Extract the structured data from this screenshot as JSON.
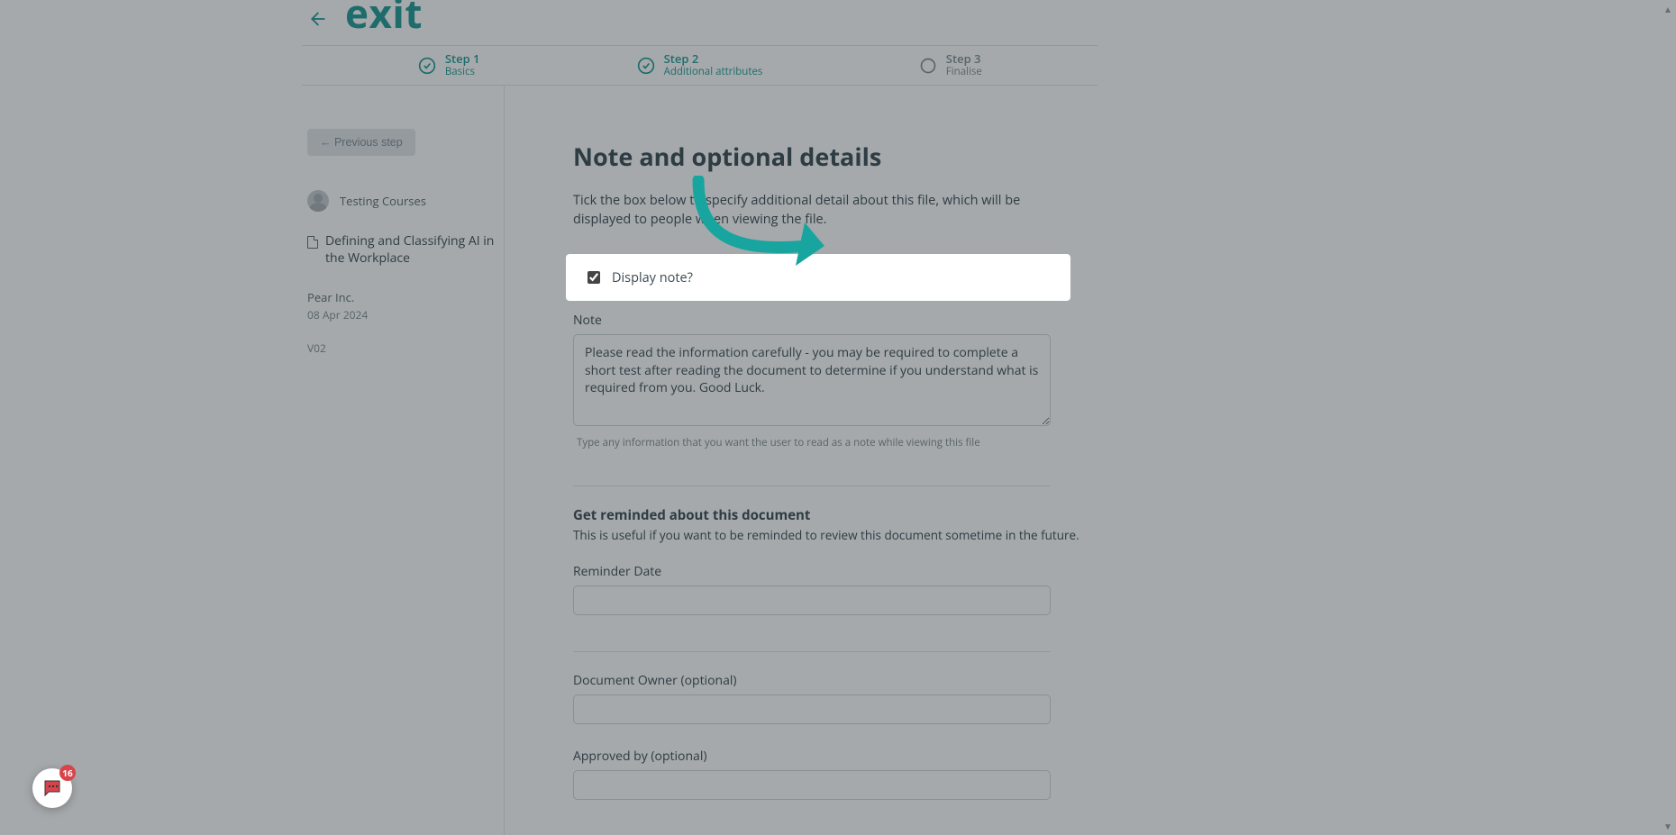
{
  "header": {
    "exit_label": "exit"
  },
  "steps": [
    {
      "num": "Step 1",
      "label": "Basics",
      "state": "done"
    },
    {
      "num": "Step 2",
      "label": "Additional attributes",
      "state": "done"
    },
    {
      "num": "Step 3",
      "label": "Finalise",
      "state": "pending"
    }
  ],
  "left": {
    "prev_button": "← Previous step",
    "course_name": "Testing Courses",
    "doc_title": "Defining and Classifying AI in the Workplace",
    "company": "Pear Inc.",
    "date": "08 Apr 2024",
    "version": "V02"
  },
  "right": {
    "section_title": "Note and optional details",
    "section_desc": "Tick the box below to specify additional detail about this file, which will be displayed to people when viewing the file.",
    "display_note_label": "Display note?",
    "display_note_checked": true,
    "note_label": "Note",
    "note_value": "Please read the information carefully - you may be required to complete a short test after reading the document to determine if you understand what is required from you. Good Luck.",
    "note_hint": "Type any information that you want the user to read as a note while viewing this file",
    "reminder_heading": "Get reminded about this document",
    "reminder_desc": "This is useful if you want to be reminded to review this document sometime in the future.",
    "reminder_date_label": "Reminder Date",
    "reminder_date_value": "",
    "owner_label": "Document Owner (optional)",
    "owner_value": "",
    "approved_label": "Approved by (optional)",
    "approved_value": ""
  },
  "chat": {
    "badge_count": "16"
  },
  "colors": {
    "accent": "#1f9a95",
    "highlight": "#18a59f",
    "badge": "#d9444a"
  }
}
